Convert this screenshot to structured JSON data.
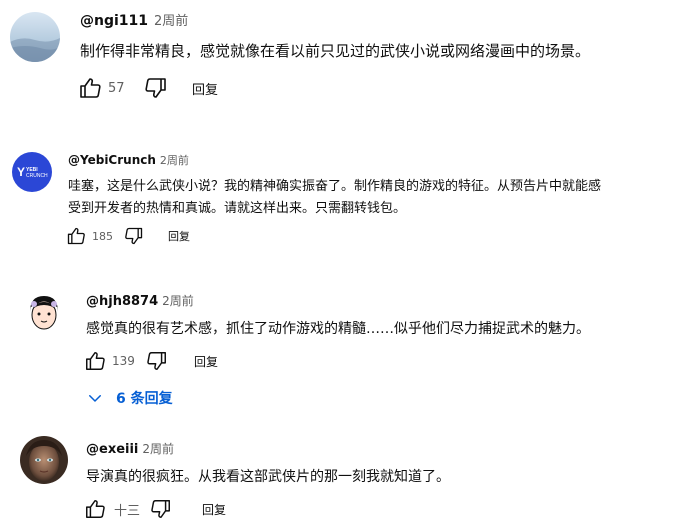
{
  "colors": {
    "link": "#065fd4",
    "muted": "#606060",
    "text": "#0f0f0f",
    "yebi_avatar": "#2b47d6"
  },
  "comments": [
    {
      "handle": "@ngi111",
      "time": "2周前",
      "text": "制作得非常精良，感觉就像在看以前只见过的武侠小说或网络漫画中的场景。",
      "likes": "57",
      "reply_label": "回复",
      "avatar_icon": "sky-photo-avatar"
    },
    {
      "handle": "@YebiCrunch",
      "time": "2周前",
      "text_line1": "哇塞，这是什么武侠小说？我的精神确实振奋了。制作精良的游戏的特征。从预告片中就能感",
      "text_line2": "受到开发者的热情和真诚。请就这样出来。只需翻转钱包。",
      "likes": "185",
      "reply_label": "回复",
      "avatar_logo": {
        "mark": "Y",
        "word1": "YEBI",
        "word2": "CRUNCH"
      }
    },
    {
      "handle": "@hjh8874",
      "time": "2周前",
      "text": "感觉真的很有艺术感，抓住了动作游戏的精髓……似乎他们尽力捕捉武术的魅力。",
      "likes": "139",
      "reply_label": "回复",
      "avatar_icon": "cartoon-face-avatar",
      "replies_toggle": "6 条回复"
    },
    {
      "handle": "@exeiii",
      "time": "2周前",
      "text": "导演真的很疯狂。从我看这部武侠片的那一刻我就知道了。",
      "likes": "十三",
      "reply_label": "回复",
      "avatar_icon": "portrait-photo-avatar"
    }
  ]
}
